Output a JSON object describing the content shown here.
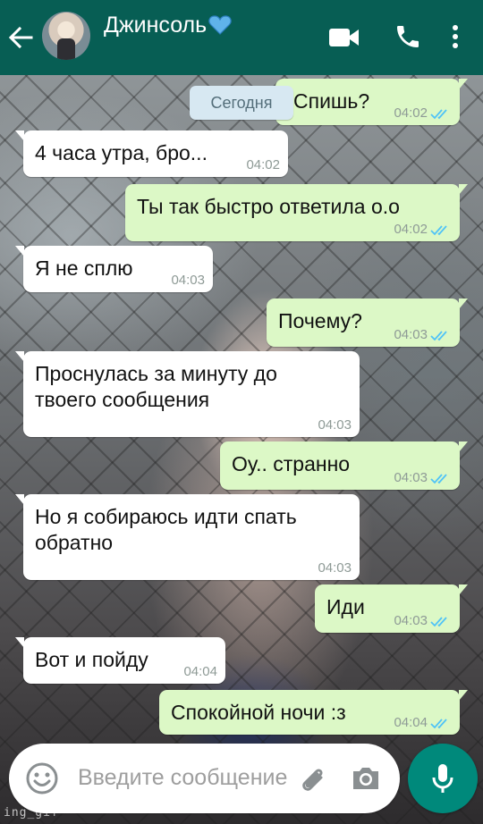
{
  "header": {
    "contact_name": "Джинсоль",
    "heart_emoji": "💙"
  },
  "chat": {
    "date_chip": "Сегодня",
    "messages": [
      {
        "dir": "out",
        "text": "Спишь?",
        "time": "04:02",
        "status": "read"
      },
      {
        "dir": "in",
        "text": "4 часа утра, бро...",
        "time": "04:02"
      },
      {
        "dir": "out",
        "text": "Ты так быстро ответила о.о",
        "time": "04:02",
        "status": "read"
      },
      {
        "dir": "in",
        "text": "Я не сплю",
        "time": "04:03"
      },
      {
        "dir": "out",
        "text": "Почему?",
        "time": "04:03",
        "status": "read"
      },
      {
        "dir": "in",
        "line1": "Проснулась за минуту до",
        "line2": "твоего сообщения",
        "time": "04:03"
      },
      {
        "dir": "out",
        "text": "Оу.. странно",
        "time": "04:03",
        "status": "read"
      },
      {
        "dir": "in",
        "line1": "Но я собираюсь идти спать",
        "line2": "обратно",
        "time": "04:03"
      },
      {
        "dir": "out",
        "text": "Иди",
        "time": "04:03",
        "status": "read"
      },
      {
        "dir": "in",
        "text": "Вот и пойду",
        "time": "04:04"
      },
      {
        "dir": "out",
        "text": "Спокойной ночи :з",
        "time": "04:04",
        "status": "read"
      }
    ]
  },
  "composer": {
    "placeholder": "Введите сообщение"
  },
  "watermark": "ing_gif",
  "colors": {
    "header": "#075e54",
    "outgoing_bubble": "#dcf8c6",
    "incoming_bubble": "#ffffff",
    "read_ticks": "#4fc3f7",
    "mic_button": "#00897b"
  },
  "icons": [
    "back-arrow-icon",
    "video-call-icon",
    "phone-icon",
    "more-vert-icon",
    "emoji-icon",
    "attach-icon",
    "camera-icon",
    "mic-icon",
    "double-check-icon"
  ]
}
